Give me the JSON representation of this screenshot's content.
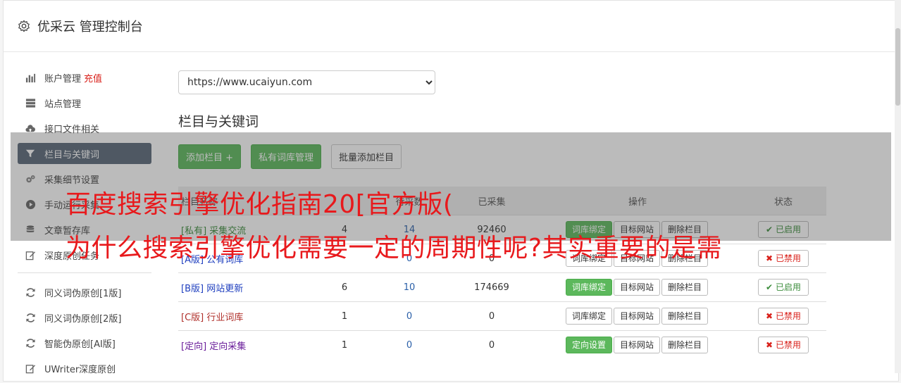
{
  "header": {
    "title": "优采云 管理控制台"
  },
  "sidebar": {
    "items": [
      {
        "label": "账户管理",
        "extra": "充值",
        "icon": "bar-chart-icon"
      },
      {
        "label": "站点管理",
        "icon": "server-icon"
      },
      {
        "label": "接口文件相关",
        "icon": "cloud-upload-icon"
      },
      {
        "label": "栏目与关键词",
        "icon": "filter-icon",
        "active": true
      },
      {
        "label": "采集细节设置",
        "icon": "gears-icon"
      },
      {
        "label": "手动运行采集",
        "icon": "play-icon"
      },
      {
        "label": "文章暂存库",
        "icon": "database-icon"
      },
      {
        "label": "深度原创任务",
        "icon": "edit-icon"
      }
    ],
    "items2": [
      {
        "label": "同义词伪原创[1版]",
        "icon": "refresh-icon"
      },
      {
        "label": "同义词伪原创[2版]",
        "icon": "refresh-icon"
      },
      {
        "label": "智能伪原创[AI版]",
        "icon": "refresh-icon"
      },
      {
        "label": "UWriter深度原创",
        "icon": "edit-icon"
      }
    ]
  },
  "main": {
    "site_select": "https://www.ucaiyun.com",
    "section_title": "栏目与关键词",
    "buttons": {
      "add": "添加栏目 +",
      "private_lib": "私有词库管理",
      "batch_add": "批量添加栏目"
    },
    "table": {
      "headers": [
        "栏目名称",
        "",
        "待采数",
        "已采集",
        "操作",
        "状态"
      ],
      "rows": [
        {
          "tag": "[私有]",
          "name": "采集交流",
          "color": "green",
          "a": "4",
          "b": "14",
          "c": "92460",
          "op1": "词库绑定",
          "op1_green": true,
          "op2": "目标网站",
          "op3": "删除栏目",
          "status": "已启用",
          "on": true
        },
        {
          "tag": "[A版]",
          "name": "公有词库",
          "color": "blue",
          "a": "",
          "b": "0",
          "c": "0",
          "op1": "词库绑定",
          "op1_green": false,
          "op2": "目标网站",
          "op3": "删除栏目",
          "status": "已禁用",
          "on": false
        },
        {
          "tag": "[B版]",
          "name": "网站更新",
          "color": "blue",
          "a": "6",
          "b": "10",
          "c": "174669",
          "op1": "词库绑定",
          "op1_green": true,
          "op2": "目标网站",
          "op3": "删除栏目",
          "status": "已启用",
          "on": true
        },
        {
          "tag": "[C版]",
          "name": "行业词库",
          "color": "red",
          "a": "1",
          "b": "0",
          "c": "0",
          "op1": "词库绑定",
          "op1_green": false,
          "op2": "目标网站",
          "op3": "删除栏目",
          "status": "已禁用",
          "on": false
        },
        {
          "tag": "[定向]",
          "name": "定向采集",
          "color": "purple",
          "a": "1",
          "b": "0",
          "c": "0",
          "op1": "定向设置",
          "op1_green": true,
          "op2": "目标网站",
          "op3": "删除栏目",
          "status": "已禁用",
          "on": false
        }
      ]
    }
  },
  "overlay": {
    "line1": "百度搜索引擎优化指南20[官方版(",
    "line2": "为什么搜索引擎优化需要一定的周期性呢?其实重要的是需"
  },
  "colors": {
    "accent_green": "#5cb85c",
    "active_nav": "#5a6779",
    "overlay_text": "#e8191c"
  }
}
